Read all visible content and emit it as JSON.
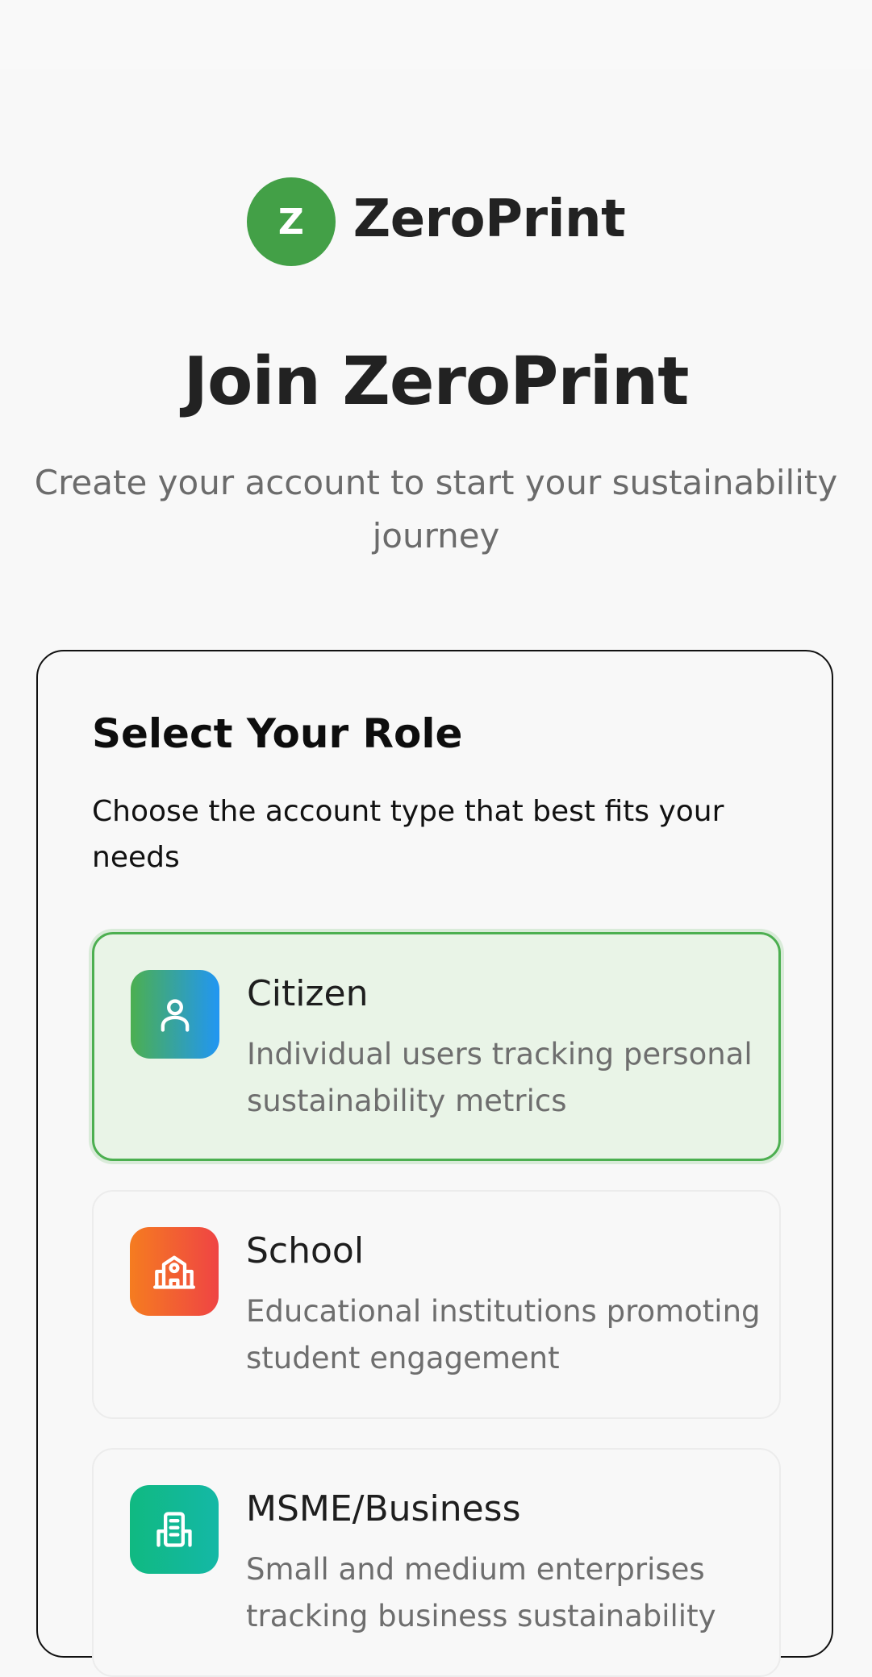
{
  "brand": {
    "logo_letter": "Z",
    "name": "ZeroPrint",
    "color": "#43a047"
  },
  "header": {
    "title": "Join ZeroPrint",
    "subtitle": "Create your account to start your sustainability journey"
  },
  "role_card": {
    "title": "Select Your Role",
    "subtitle": "Choose the account type that best fits your needs",
    "options": [
      {
        "title": "Citizen",
        "description": "Individual users tracking personal sustainability metrics",
        "icon": "user-icon",
        "selected": true
      },
      {
        "title": "School",
        "description": "Educational institutions promoting student engagement",
        "icon": "school-icon",
        "selected": false
      },
      {
        "title": "MSME/Business",
        "description": "Small and medium enterprises tracking business sustainability",
        "icon": "building-icon",
        "selected": false
      }
    ]
  },
  "colors": {
    "accent": "#4caf50",
    "selected_bg": "#e9f4e7"
  }
}
